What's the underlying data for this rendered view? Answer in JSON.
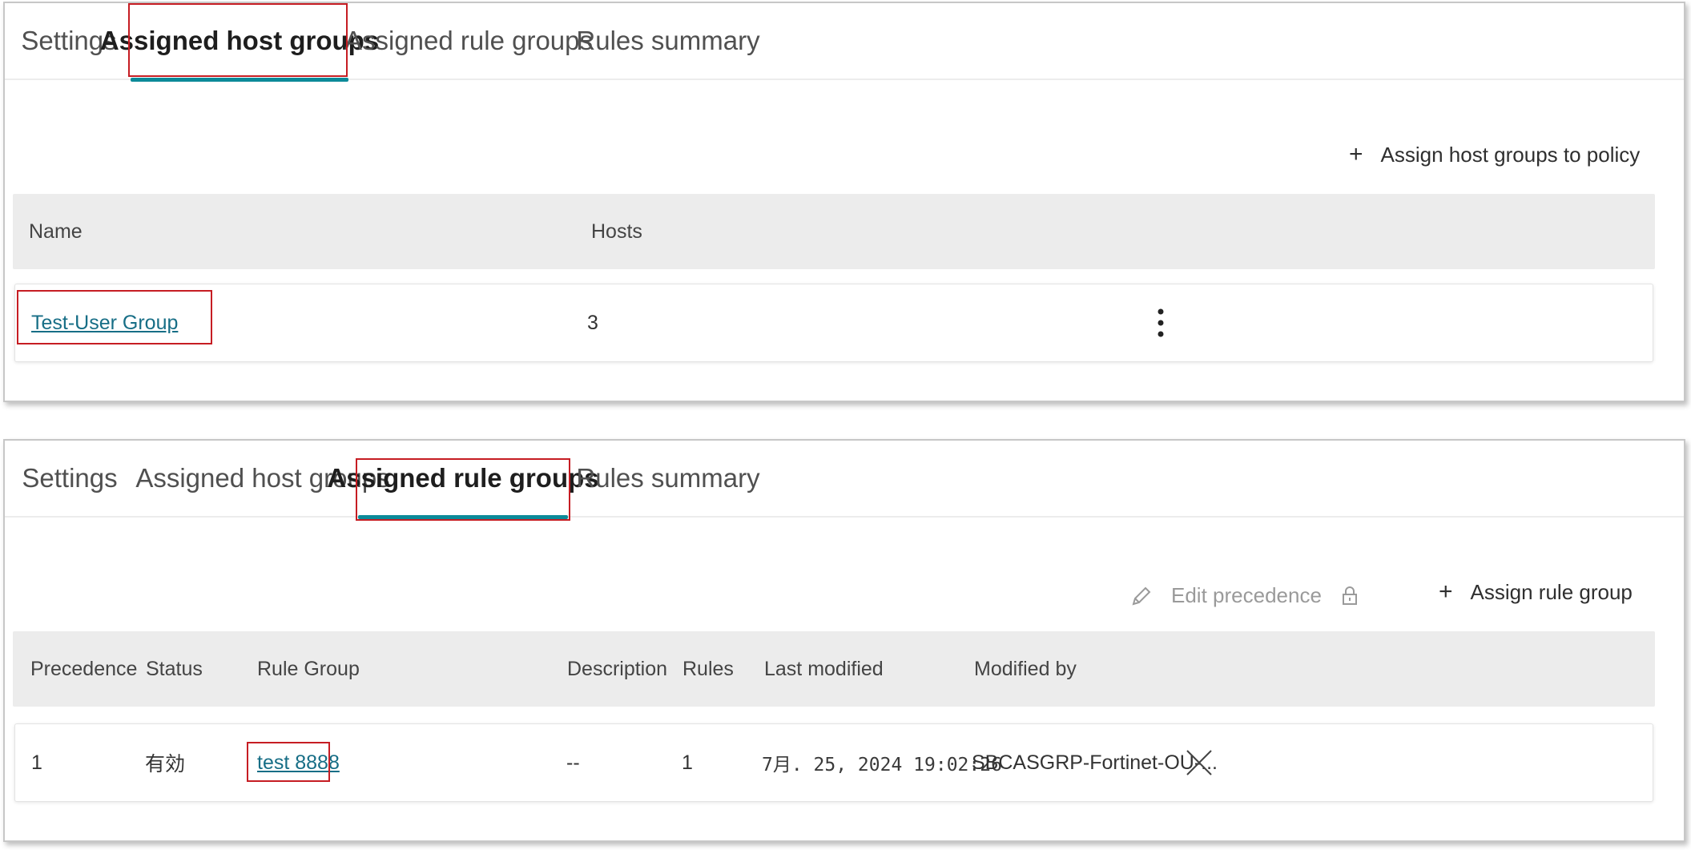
{
  "host_panel": {
    "tabs": [
      "Settings",
      "Assigned host groups",
      "Assigned rule groups",
      "Rules summary"
    ],
    "active_tab": "Assigned host groups",
    "assign_action": {
      "icon": "plus-icon",
      "label": "Assign host groups to policy"
    },
    "columns": [
      "Name",
      "Hosts"
    ],
    "rows": [
      {
        "name": "Test-User Group",
        "hosts": "3",
        "menu_icon": "kebab-menu-icon"
      }
    ]
  },
  "rule_panel": {
    "tabs": [
      "Settings",
      "Assigned host groups",
      "Assigned rule groups",
      "Rules summary"
    ],
    "active_tab": "Assigned rule groups",
    "edit_action": {
      "icon": "pencil-icon",
      "label": "Edit precedence",
      "lock_icon": "lock-icon"
    },
    "assign_action": {
      "icon": "plus-icon",
      "label": "Assign rule group"
    },
    "columns": [
      "Precedence",
      "Status",
      "Rule Group",
      "Description",
      "Rules",
      "Last modified",
      "Modified by"
    ],
    "rows": [
      {
        "precedence": "1",
        "status": "有効",
        "rule_group": "test 8888",
        "description": "--",
        "rules": "1",
        "last_modified": "7月. 25, 2024 19:02:26",
        "modified_by": "SBCASGRP-Fortinet-OU-...",
        "remove_icon": "close-icon"
      }
    ]
  },
  "colors": {
    "accent": "#0c8a99",
    "highlight_box": "#c61d23",
    "link": "#176e86",
    "header_bg": "#ececec"
  }
}
